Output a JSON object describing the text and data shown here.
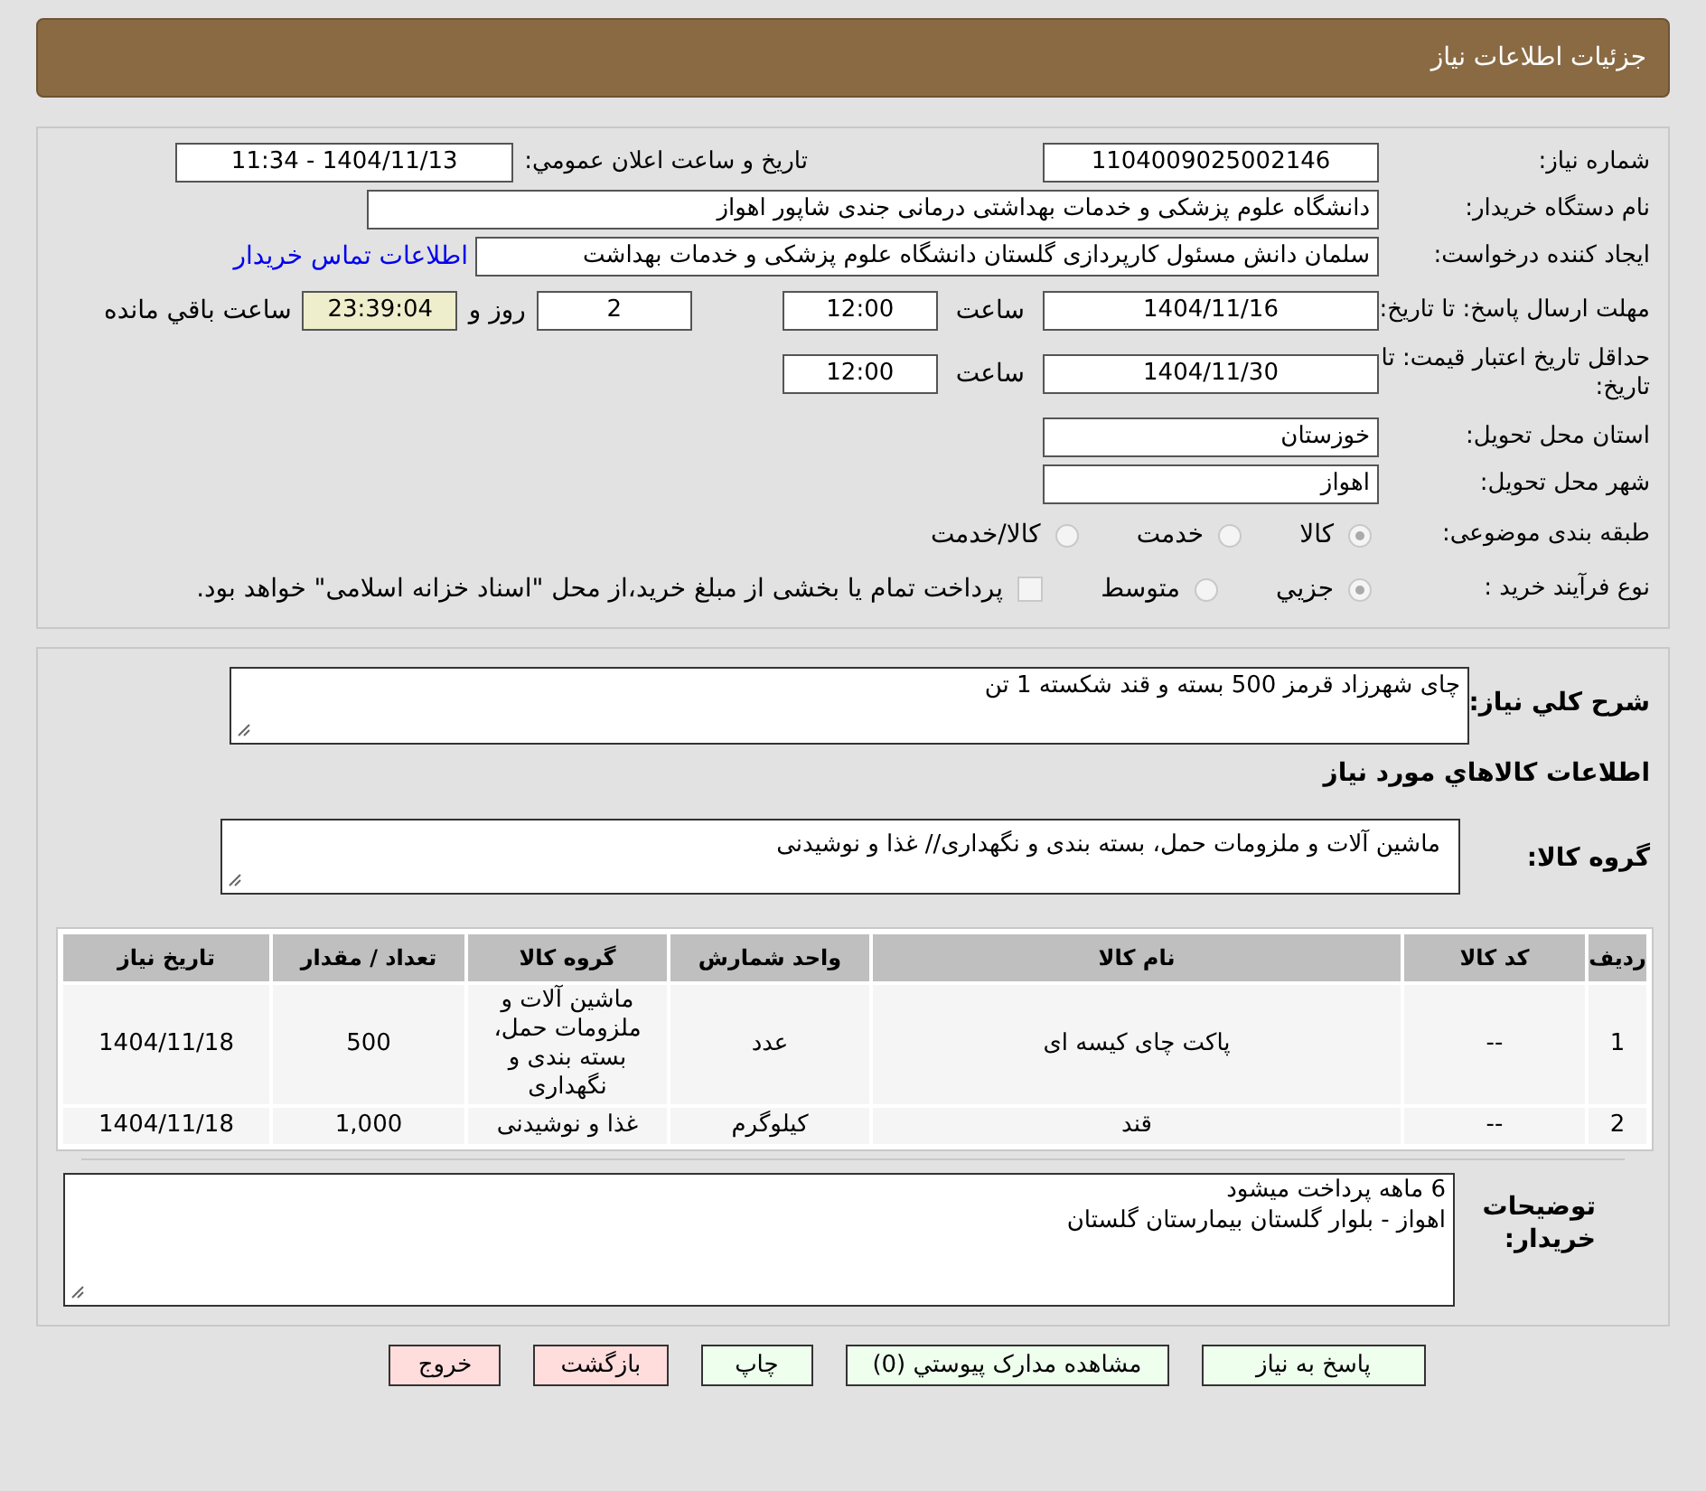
{
  "header": {
    "title": "جزئیات اطلاعات نیاز"
  },
  "need_number": {
    "label": "شماره نیاز:",
    "value": "1104009025002146"
  },
  "announce": {
    "label": "تاریخ و ساعت اعلان عمومي:",
    "value": "1404/11/13 - 11:34"
  },
  "buyer_org": {
    "label": "نام دستگاه خريدار:",
    "value": "دانشگاه علوم پزشکی و خدمات بهداشتی درمانی جندی شاپور اهواز"
  },
  "requester": {
    "label": "ايجاد کننده درخواست:",
    "value": "سلمان دانش مسئول کارپردازی گلستان دانشگاه علوم پزشکی و خدمات بهداشت",
    "link": "اطلاعات تماس خريدار"
  },
  "reply_deadline": {
    "label": "مهلت ارسال پاسخ: تا تاریخ:",
    "date": "1404/11/16",
    "time_label": "ساعت",
    "time": "12:00",
    "days": "2",
    "days_label": "روز و",
    "remaining": "23:39:04",
    "remaining_label": "ساعت باقي مانده"
  },
  "price_validity": {
    "label": "حداقل تاریخ اعتبار قیمت: تا تاریخ:",
    "date": "1404/11/30",
    "time_label": "ساعت",
    "time": "12:00"
  },
  "province": {
    "label": "استان محل تحویل:",
    "value": "خوزستان"
  },
  "city": {
    "label": "شهر محل تحویل:",
    "value": "اهواز"
  },
  "category": {
    "label": "طبقه بندی موضوعی:",
    "options": [
      {
        "label": "کالا",
        "selected": true
      },
      {
        "label": "خدمت",
        "selected": false
      },
      {
        "label": "کالا/خدمت",
        "selected": false
      }
    ]
  },
  "purchase_type": {
    "label": "نوع فرآیند خرید :",
    "options": [
      {
        "label": "جزيي",
        "selected": true
      },
      {
        "label": "متوسط",
        "selected": false
      }
    ],
    "payment": {
      "checked": false,
      "label": "پرداخت تمام یا بخشی از مبلغ خرید،از محل \"اسناد خزانه اسلامی\" خواهد بود."
    }
  },
  "description": {
    "label": "شرح کلي نياز:",
    "value": "چای شهرزاد قرمز 500 بسته و قند شکسته 1 تن"
  },
  "goods_title": "اطلاعات کالاهاي مورد نياز",
  "goods_group": {
    "label": "گروه کالا:",
    "value": "ماشین آلات و ملزومات حمل، بسته بندی و نگهداری// غذا و نوشیدنی"
  },
  "table": {
    "columns": [
      "رديف",
      "کد کالا",
      "نام کالا",
      "واحد شمارش",
      "گروه کالا",
      "تعداد / مقدار",
      "تاريخ نياز"
    ],
    "rows": [
      [
        "1",
        "--",
        "پاکت چای کیسه ای",
        "عدد",
        "ماشین آلات و ملزومات حمل، بسته بندی و نگهداری",
        "500",
        "1404/11/18"
      ],
      [
        "2",
        "--",
        "قند",
        "کیلوگرم",
        "غذا و نوشیدنی",
        "1,000",
        "1404/11/18"
      ]
    ]
  },
  "buyer_notes": {
    "label": "توضیحات خریدار:",
    "lines": [
      "6 ماهه پرداخت میشود",
      "اهواز - بلوار گلستان بیمارستان گلستان"
    ]
  },
  "buttons": [
    {
      "label": "پاسخ به نياز",
      "color": "#eeffee"
    },
    {
      "label": "مشاهده مدارک پيوستي (0)",
      "color": "#eeffee"
    },
    {
      "label": "چاپ",
      "color": "#eeffee"
    },
    {
      "label": "بازگشت",
      "color": "#ffdddd"
    },
    {
      "label": "خروج",
      "color": "#ffdddd"
    }
  ]
}
